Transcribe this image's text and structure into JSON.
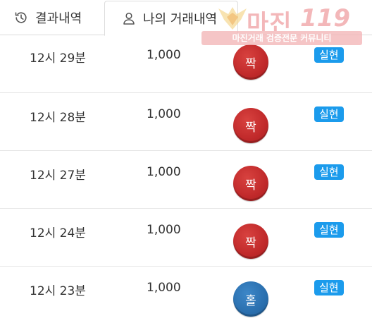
{
  "tabs": {
    "results": {
      "label": "결과내역",
      "icon": "history-icon"
    },
    "my_trades": {
      "label": "나의 거래내역",
      "icon": "user-icon"
    }
  },
  "watermark": {
    "brand": "마진",
    "number": "119",
    "tagline": "마진거래 검증전문 커뮤니티"
  },
  "colors": {
    "even_ball": "#c0292a",
    "odd_ball": "#2a6fae",
    "badge": "#1b9bec"
  },
  "rows": [
    {
      "time": "12시 29분",
      "amount": "1,000",
      "result": "짝",
      "status": "실현"
    },
    {
      "time": "12시 28분",
      "amount": "1,000",
      "result": "짝",
      "status": "실현"
    },
    {
      "time": "12시 27분",
      "amount": "1,000",
      "result": "짝",
      "status": "실현"
    },
    {
      "time": "12시 24분",
      "amount": "1,000",
      "result": "짝",
      "status": "실현"
    },
    {
      "time": "12시 23분",
      "amount": "1,000",
      "result": "홀",
      "status": "실현"
    }
  ]
}
